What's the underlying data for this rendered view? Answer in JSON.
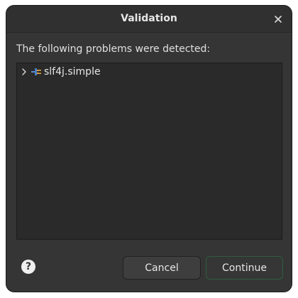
{
  "dialog": {
    "title": "Validation",
    "message": "The following problems were detected:"
  },
  "tree": {
    "items": [
      {
        "label": "slf4j.simple",
        "icon": "plugin-icon",
        "expanded": false
      }
    ]
  },
  "buttons": {
    "cancel": "Cancel",
    "continue": "Continue",
    "help": "?"
  },
  "colors": {
    "background": "#353535",
    "tree_background": "#2a2a2a",
    "continue_border": "#2d5e40",
    "text": "#e6e6e6"
  }
}
